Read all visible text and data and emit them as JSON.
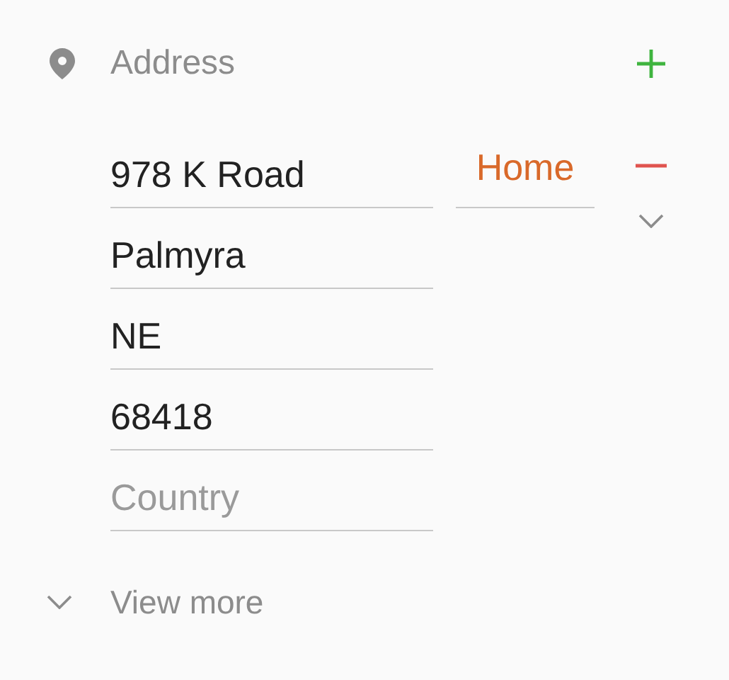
{
  "section": {
    "title": "Address"
  },
  "fields": [
    {
      "value": "978 K Road"
    },
    {
      "value": "Palmyra"
    },
    {
      "value": "NE"
    },
    {
      "value": "68418"
    },
    {
      "placeholder": "Country"
    }
  ],
  "type_selector": {
    "value": "Home"
  },
  "view_more": {
    "label": "View more"
  }
}
